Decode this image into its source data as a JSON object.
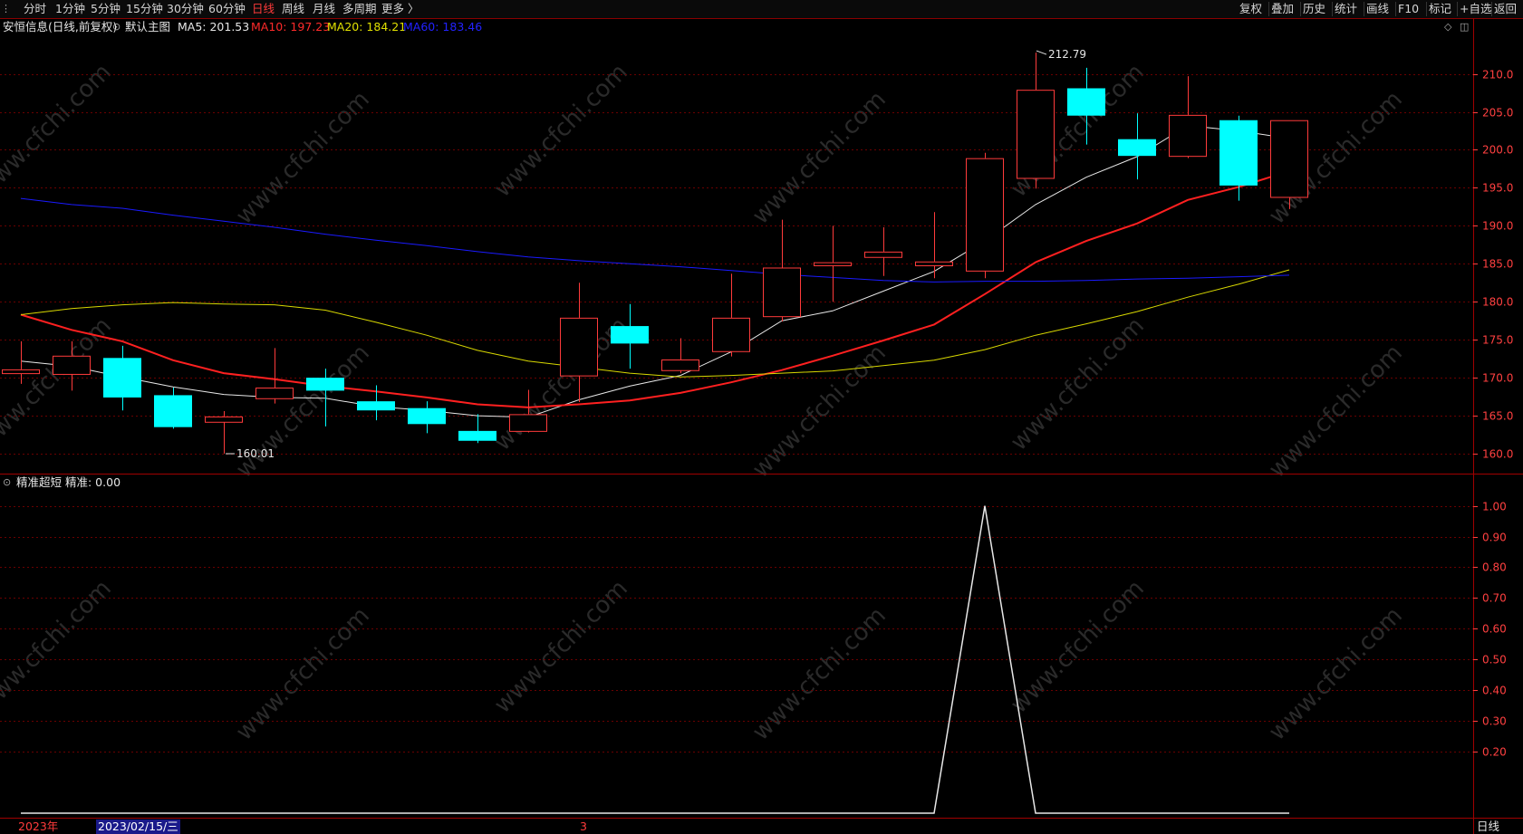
{
  "toolbar": {
    "left_items": [
      {
        "label": "分时",
        "active": false
      },
      {
        "label": "1分钟",
        "active": false
      },
      {
        "label": "5分钟",
        "active": false
      },
      {
        "label": "15分钟",
        "active": false
      },
      {
        "label": "30分钟",
        "active": false
      },
      {
        "label": "60分钟",
        "active": false
      },
      {
        "label": "日线",
        "active": true
      },
      {
        "label": "周线",
        "active": false
      },
      {
        "label": "月线",
        "active": false
      },
      {
        "label": "多周期",
        "active": false
      },
      {
        "label": "更多 〉",
        "active": false
      }
    ],
    "right_items": [
      "复权",
      "叠加",
      "历史",
      "统计",
      "画线",
      "F10",
      "标记",
      "+自选",
      "返回"
    ]
  },
  "main_header": {
    "stock_title": "安恒信息(日线,前复权)",
    "indicator_name": "默认主图",
    "ma5": "MA5: 201.53",
    "ma10": "MA10: 197.23",
    "ma20": "MA20: 184.21",
    "ma60": "MA60: 183.46"
  },
  "sub_header": {
    "indicator_name": "精准超短",
    "value": "精准: 0.00"
  },
  "colors": {
    "up": "#ff3b3b",
    "down": "#00ffff",
    "ma5": "#e8e8e8",
    "ma10": "#ff2020",
    "ma20": "#d8d800",
    "ma60": "#1a1aff",
    "axis": "#ff4040",
    "grid": "#6a0000"
  },
  "chart_data": [
    {
      "type": "candlestick",
      "title": "安恒信息(日线,前复权)",
      "ylim": [
        157.5,
        214
      ],
      "y_ticks": [
        160.0,
        165.0,
        170.0,
        175.0,
        180.0,
        185.0,
        190.0,
        195.0,
        200.0,
        205.0,
        210.0
      ],
      "max_label": "212.79",
      "min_label": "160.01",
      "candles": [
        {
          "o": 170.6,
          "c": 171.1,
          "h": 174.8,
          "l": 169.2
        },
        {
          "o": 170.5,
          "c": 172.9,
          "h": 174.8,
          "l": 168.3
        },
        {
          "o": 172.6,
          "c": 167.4,
          "h": 174.2,
          "l": 165.7
        },
        {
          "o": 167.7,
          "c": 163.5,
          "h": 168.7,
          "l": 163.3
        },
        {
          "o": 164.2,
          "c": 164.9,
          "h": 165.6,
          "l": 160.0
        },
        {
          "o": 167.3,
          "c": 168.7,
          "h": 173.9,
          "l": 166.6
        },
        {
          "o": 170.0,
          "c": 168.3,
          "h": 171.2,
          "l": 163.6
        },
        {
          "o": 166.9,
          "c": 165.7,
          "h": 169.0,
          "l": 164.4
        },
        {
          "o": 166.0,
          "c": 163.9,
          "h": 166.9,
          "l": 162.7
        },
        {
          "o": 163.0,
          "c": 161.7,
          "h": 165.2,
          "l": 161.4
        },
        {
          "o": 163.0,
          "c": 165.2,
          "h": 168.4,
          "l": 162.8
        },
        {
          "o": 170.3,
          "c": 177.9,
          "h": 182.5,
          "l": 166.8
        },
        {
          "o": 176.8,
          "c": 174.5,
          "h": 179.7,
          "l": 171.2
        },
        {
          "o": 171.0,
          "c": 172.4,
          "h": 175.2,
          "l": 170.6
        },
        {
          "o": 173.5,
          "c": 177.9,
          "h": 183.7,
          "l": 172.8
        },
        {
          "o": 178.1,
          "c": 184.5,
          "h": 190.8,
          "l": 177.4
        },
        {
          "o": 184.8,
          "c": 185.2,
          "h": 190.0,
          "l": 180.0
        },
        {
          "o": 185.9,
          "c": 186.6,
          "h": 189.8,
          "l": 183.4
        },
        {
          "o": 184.8,
          "c": 185.3,
          "h": 191.8,
          "l": 183.1
        },
        {
          "o": 184.1,
          "c": 198.9,
          "h": 199.6,
          "l": 183.1
        },
        {
          "o": 196.3,
          "c": 207.9,
          "h": 212.8,
          "l": 194.9
        },
        {
          "o": 208.1,
          "c": 204.5,
          "h": 210.8,
          "l": 200.7
        },
        {
          "o": 201.4,
          "c": 199.2,
          "h": 204.8,
          "l": 196.1
        },
        {
          "o": 199.2,
          "c": 204.6,
          "h": 209.7,
          "l": 198.9
        },
        {
          "o": 203.9,
          "c": 195.3,
          "h": 204.5,
          "l": 193.3
        },
        {
          "o": 193.8,
          "c": 203.9,
          "h": 203.9,
          "l": 192.2
        }
      ],
      "series": [
        {
          "name": "MA5",
          "values": [
            172.2,
            171.5,
            170.1,
            168.8,
            167.8,
            167.4,
            167.3,
            166.2,
            165.7,
            165.0,
            164.8,
            167.1,
            168.9,
            170.3,
            173.4,
            177.5,
            178.8,
            181.4,
            184.0,
            188.0,
            192.8,
            196.4,
            199.1,
            203.2,
            202.5,
            201.5
          ]
        },
        {
          "name": "MA10",
          "values": [
            178.3,
            176.3,
            174.8,
            172.3,
            170.6,
            169.8,
            168.9,
            168.2,
            167.4,
            166.5,
            166.1,
            166.5,
            167.0,
            168.0,
            169.4,
            171.0,
            172.9,
            174.9,
            177.0,
            181.0,
            185.2,
            188.0,
            190.3,
            193.4,
            195.1,
            197.2
          ]
        },
        {
          "name": "MA20",
          "values": [
            178.3,
            179.1,
            179.6,
            179.9,
            179.7,
            179.6,
            178.9,
            177.3,
            175.6,
            173.6,
            172.2,
            171.4,
            170.6,
            170.1,
            170.3,
            170.6,
            170.9,
            171.6,
            172.3,
            173.7,
            175.6,
            177.1,
            178.7,
            180.6,
            182.3,
            184.2
          ]
        },
        {
          "name": "MA60",
          "values": [
            193.6,
            192.8,
            192.3,
            191.4,
            190.6,
            189.8,
            188.9,
            188.1,
            187.4,
            186.6,
            185.9,
            185.4,
            185.0,
            184.6,
            184.1,
            183.6,
            183.2,
            182.8,
            182.6,
            182.7,
            182.7,
            182.8,
            183.0,
            183.1,
            183.3,
            183.5
          ]
        }
      ]
    },
    {
      "type": "line",
      "title": "精准超短",
      "ylim": [
        0,
        1.04
      ],
      "y_ticks": [
        0.2,
        0.3,
        0.4,
        0.5,
        0.6,
        0.7,
        0.8,
        0.9,
        1.0
      ],
      "series": [
        {
          "name": "精准",
          "values": [
            0,
            0,
            0,
            0,
            0,
            0,
            0,
            0,
            0,
            0,
            0,
            0,
            0,
            0,
            0,
            0,
            0,
            0,
            0,
            1,
            0,
            0,
            0,
            0,
            0,
            0
          ]
        }
      ]
    }
  ],
  "bottom_bar": {
    "year_label": "2023年",
    "cursor_date": "2023/02/15/三",
    "month_mark": "3",
    "period_label": "日线"
  },
  "watermark_text": "www.cfchi.com"
}
